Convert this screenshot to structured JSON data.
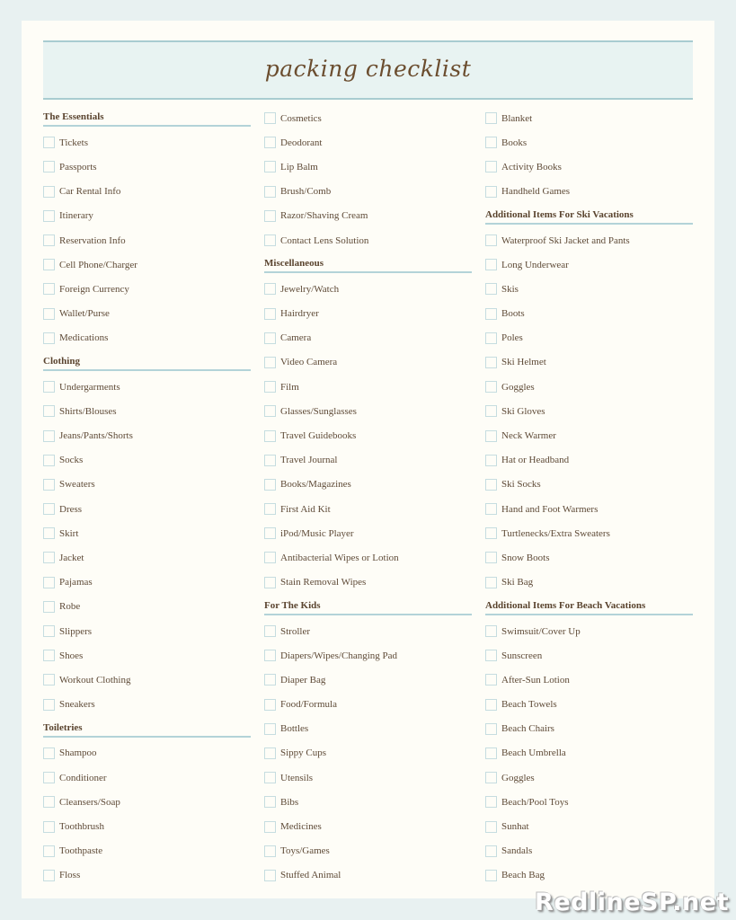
{
  "title": "packing checklist",
  "watermark": "RedlineSP.net",
  "colors": {
    "background": "#e8f1f1",
    "paper": "#fefdf7",
    "header_fill": "#e8f3f2",
    "accent_rule": "#a8ccd1",
    "text": "#5e4a37",
    "checkbox_border": "#c6dde0"
  },
  "columns": [
    [
      {
        "type": "section",
        "label": "The Essentials"
      },
      {
        "type": "item",
        "label": "Tickets",
        "checked": false
      },
      {
        "type": "item",
        "label": "Passports",
        "checked": false
      },
      {
        "type": "item",
        "label": "Car Rental Info",
        "checked": false
      },
      {
        "type": "item",
        "label": "Itinerary",
        "checked": false
      },
      {
        "type": "item",
        "label": "Reservation Info",
        "checked": false
      },
      {
        "type": "item",
        "label": "Cell Phone/Charger",
        "checked": false
      },
      {
        "type": "item",
        "label": "Foreign Currency",
        "checked": false
      },
      {
        "type": "item",
        "label": "Wallet/Purse",
        "checked": false
      },
      {
        "type": "item",
        "label": "Medications",
        "checked": false
      },
      {
        "type": "section",
        "label": "Clothing"
      },
      {
        "type": "item",
        "label": "Undergarments",
        "checked": false
      },
      {
        "type": "item",
        "label": "Shirts/Blouses",
        "checked": false
      },
      {
        "type": "item",
        "label": "Jeans/Pants/Shorts",
        "checked": false
      },
      {
        "type": "item",
        "label": "Socks",
        "checked": false
      },
      {
        "type": "item",
        "label": "Sweaters",
        "checked": false
      },
      {
        "type": "item",
        "label": "Dress",
        "checked": false
      },
      {
        "type": "item",
        "label": "Skirt",
        "checked": false
      },
      {
        "type": "item",
        "label": "Jacket",
        "checked": false
      },
      {
        "type": "item",
        "label": "Pajamas",
        "checked": false
      },
      {
        "type": "item",
        "label": "Robe",
        "checked": false
      },
      {
        "type": "item",
        "label": "Slippers",
        "checked": false
      },
      {
        "type": "item",
        "label": "Shoes",
        "checked": false
      },
      {
        "type": "item",
        "label": "Workout Clothing",
        "checked": false
      },
      {
        "type": "item",
        "label": "Sneakers",
        "checked": false
      },
      {
        "type": "section",
        "label": "Toiletries"
      },
      {
        "type": "item",
        "label": "Shampoo",
        "checked": false
      },
      {
        "type": "item",
        "label": "Conditioner",
        "checked": false
      },
      {
        "type": "item",
        "label": "Cleansers/Soap",
        "checked": false
      },
      {
        "type": "item",
        "label": "Toothbrush",
        "checked": false
      },
      {
        "type": "item",
        "label": "Toothpaste",
        "checked": false
      },
      {
        "type": "item",
        "label": "Floss",
        "checked": false
      }
    ],
    [
      {
        "type": "item",
        "label": "Cosmetics",
        "checked": false
      },
      {
        "type": "item",
        "label": "Deodorant",
        "checked": false
      },
      {
        "type": "item",
        "label": "Lip Balm",
        "checked": false
      },
      {
        "type": "item",
        "label": "Brush/Comb",
        "checked": false
      },
      {
        "type": "item",
        "label": "Razor/Shaving Cream",
        "checked": false
      },
      {
        "type": "item",
        "label": "Contact Lens Solution",
        "checked": false
      },
      {
        "type": "section",
        "label": "Miscellaneous"
      },
      {
        "type": "item",
        "label": "Jewelry/Watch",
        "checked": false
      },
      {
        "type": "item",
        "label": "Hairdryer",
        "checked": false
      },
      {
        "type": "item",
        "label": "Camera",
        "checked": false
      },
      {
        "type": "item",
        "label": "Video Camera",
        "checked": false
      },
      {
        "type": "item",
        "label": "Film",
        "checked": false
      },
      {
        "type": "item",
        "label": "Glasses/Sunglasses",
        "checked": false
      },
      {
        "type": "item",
        "label": "Travel Guidebooks",
        "checked": false
      },
      {
        "type": "item",
        "label": "Travel Journal",
        "checked": false
      },
      {
        "type": "item",
        "label": "Books/Magazines",
        "checked": false
      },
      {
        "type": "item",
        "label": "First Aid Kit",
        "checked": false
      },
      {
        "type": "item",
        "label": "iPod/Music Player",
        "checked": false
      },
      {
        "type": "item",
        "label": "Antibacterial Wipes or Lotion",
        "checked": false
      },
      {
        "type": "item",
        "label": "Stain Removal Wipes",
        "checked": false
      },
      {
        "type": "section",
        "label": "For The Kids"
      },
      {
        "type": "item",
        "label": "Stroller",
        "checked": false
      },
      {
        "type": "item",
        "label": "Diapers/Wipes/Changing Pad",
        "checked": false
      },
      {
        "type": "item",
        "label": "Diaper Bag",
        "checked": false
      },
      {
        "type": "item",
        "label": "Food/Formula",
        "checked": false
      },
      {
        "type": "item",
        "label": "Bottles",
        "checked": false
      },
      {
        "type": "item",
        "label": "Sippy Cups",
        "checked": false
      },
      {
        "type": "item",
        "label": "Utensils",
        "checked": false
      },
      {
        "type": "item",
        "label": "Bibs",
        "checked": false
      },
      {
        "type": "item",
        "label": "Medicines",
        "checked": false
      },
      {
        "type": "item",
        "label": "Toys/Games",
        "checked": false
      },
      {
        "type": "item",
        "label": "Stuffed Animal",
        "checked": false
      }
    ],
    [
      {
        "type": "item",
        "label": "Blanket",
        "checked": false
      },
      {
        "type": "item",
        "label": "Books",
        "checked": false
      },
      {
        "type": "item",
        "label": "Activity Books",
        "checked": false
      },
      {
        "type": "item",
        "label": "Handheld Games",
        "checked": false
      },
      {
        "type": "section",
        "label": "Additional Items For Ski Vacations"
      },
      {
        "type": "item",
        "label": "Waterproof Ski Jacket and Pants",
        "checked": false
      },
      {
        "type": "item",
        "label": "Long Underwear",
        "checked": false
      },
      {
        "type": "item",
        "label": "Skis",
        "checked": false
      },
      {
        "type": "item",
        "label": "Boots",
        "checked": false
      },
      {
        "type": "item",
        "label": "Poles",
        "checked": false
      },
      {
        "type": "item",
        "label": "Ski Helmet",
        "checked": false
      },
      {
        "type": "item",
        "label": "Goggles",
        "checked": false
      },
      {
        "type": "item",
        "label": "Ski Gloves",
        "checked": false
      },
      {
        "type": "item",
        "label": "Neck Warmer",
        "checked": false
      },
      {
        "type": "item",
        "label": "Hat or Headband",
        "checked": false
      },
      {
        "type": "item",
        "label": "Ski Socks",
        "checked": false
      },
      {
        "type": "item",
        "label": "Hand and Foot Warmers",
        "checked": false
      },
      {
        "type": "item",
        "label": "Turtlenecks/Extra Sweaters",
        "checked": false
      },
      {
        "type": "item",
        "label": "Snow Boots",
        "checked": false
      },
      {
        "type": "item",
        "label": "Ski Bag",
        "checked": false
      },
      {
        "type": "section",
        "label": "Additional Items For Beach Vacations"
      },
      {
        "type": "item",
        "label": "Swimsuit/Cover Up",
        "checked": false
      },
      {
        "type": "item",
        "label": "Sunscreen",
        "checked": false
      },
      {
        "type": "item",
        "label": "After-Sun Lotion",
        "checked": false
      },
      {
        "type": "item",
        "label": "Beach Towels",
        "checked": false
      },
      {
        "type": "item",
        "label": "Beach Chairs",
        "checked": false
      },
      {
        "type": "item",
        "label": "Beach Umbrella",
        "checked": false
      },
      {
        "type": "item",
        "label": "Goggles",
        "checked": false
      },
      {
        "type": "item",
        "label": "Beach/Pool Toys",
        "checked": false
      },
      {
        "type": "item",
        "label": "Sunhat",
        "checked": false
      },
      {
        "type": "item",
        "label": "Sandals",
        "checked": false
      },
      {
        "type": "item",
        "label": "Beach Bag",
        "checked": false
      }
    ]
  ]
}
